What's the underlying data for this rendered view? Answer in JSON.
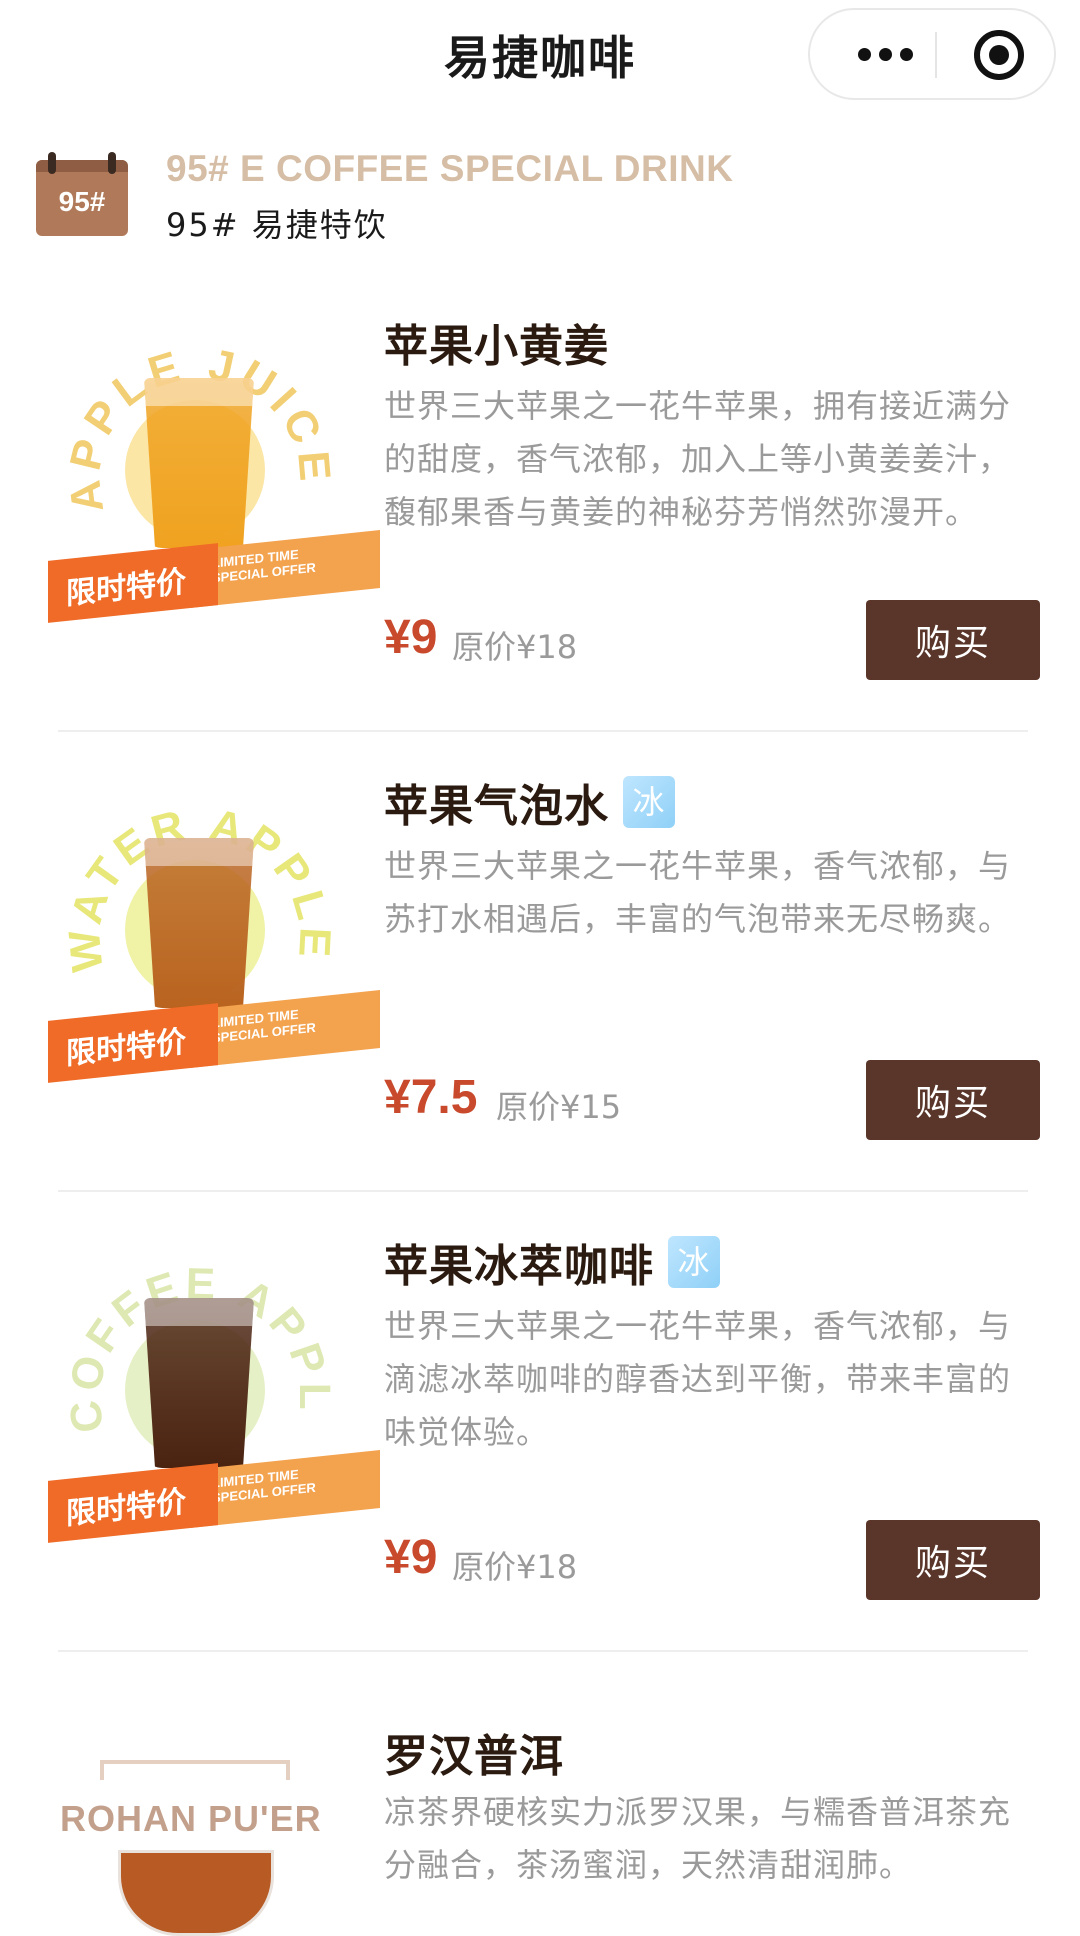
{
  "app": {
    "title": "易捷咖啡"
  },
  "section": {
    "icon_text": "95#",
    "title_en": "95# E COFFEE SPECIAL DRINK",
    "title_cn": "95# 易捷特饮"
  },
  "badge": {
    "cn": "限时特价",
    "en_line1": "LIMITED TIME",
    "en_line2": "SPECIAL OFFER"
  },
  "products": [
    {
      "name": "苹果小黄姜",
      "ice_tag": "",
      "desc": "世界三大苹果之一花牛苹果，拥有接近满分的甜度，香气浓郁，加入上等小黄姜姜汁，馥郁果香与黄姜的神秘芬芳悄然弥漫开。",
      "price": "¥9",
      "orig_price": "原价¥18",
      "buy": "购买",
      "ring_text": "APPLE JUICE",
      "ring_color": "#f2cf74",
      "glow_color": "#fbe6a6",
      "drink_color": "#f0a21f"
    },
    {
      "name": "苹果气泡水",
      "ice_tag": "冰",
      "desc": "世界三大苹果之一花牛苹果，香气浓郁，与苏打水相遇后，丰富的气泡带来无尽畅爽。",
      "price": "¥7.5",
      "orig_price": "原价¥15",
      "buy": "购买",
      "ring_text": "WATER APPLE SP",
      "ring_color": "#e8e77a",
      "glow_color": "#f0f2a6",
      "drink_color": "#b9631f"
    },
    {
      "name": "苹果冰萃咖啡",
      "ice_tag": "冰",
      "desc": "世界三大苹果之一花牛苹果，香气浓郁，与滴滤冰萃咖啡的醇香达到平衡，带来丰富的味觉体验。",
      "price": "¥9",
      "orig_price": "原价¥18",
      "buy": "购买",
      "ring_text": "COFFEE APPLE CO",
      "ring_color": "#dde8b2",
      "glow_color": "#e6f0c6",
      "drink_color": "#4a2210"
    },
    {
      "name": "罗汉普洱",
      "desc": "凉茶界硬核实力派罗汉果，与糯香普洱茶充分融合，茶汤蜜润，天然清甜润肺。",
      "logo_text": "ROHAN PU'ER"
    }
  ]
}
